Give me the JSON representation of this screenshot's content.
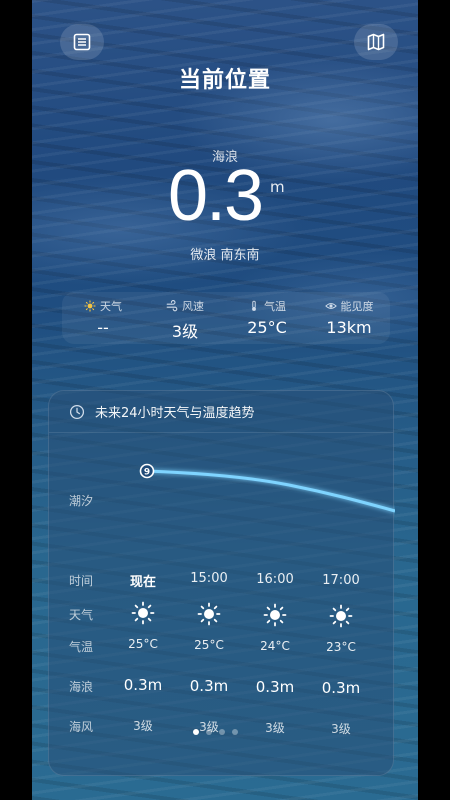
{
  "header": {
    "title": "当前位置",
    "left_icon": "list-icon",
    "right_icon": "map-icon"
  },
  "current": {
    "label": "海浪",
    "value": "0.3",
    "unit": "m",
    "desc": "微浪  南东南"
  },
  "stats": [
    {
      "icon": "sun-icon",
      "label": "天气",
      "value": "--"
    },
    {
      "icon": "wind-icon",
      "label": "风速",
      "value": "3级"
    },
    {
      "icon": "thermometer-icon",
      "label": "气温",
      "value": "25°C"
    },
    {
      "icon": "eye-icon",
      "label": "能见度",
      "value": "13km"
    }
  ],
  "forecast": {
    "title": "未来24小时天气与温度趋势",
    "tide_label": "潮汐",
    "tide_marker": "9",
    "row_labels": [
      "时间",
      "天气",
      "气温",
      "海浪",
      "海风"
    ],
    "columns": [
      {
        "time": "现在",
        "weather_icon": "sun-icon",
        "temp": "25°C",
        "wave": "0.3m",
        "wind": "3级"
      },
      {
        "time": "15:00",
        "weather_icon": "sun-icon",
        "temp": "25°C",
        "wave": "0.3m",
        "wind": "3级"
      },
      {
        "time": "16:00",
        "weather_icon": "sun-icon",
        "temp": "24°C",
        "wave": "0.3m",
        "wind": "3级"
      },
      {
        "time": "17:00",
        "weather_icon": "sun-icon",
        "temp": "23°C",
        "wave": "0.3m",
        "wind": "3级"
      }
    ],
    "page_count": 4,
    "active_page": 1
  }
}
